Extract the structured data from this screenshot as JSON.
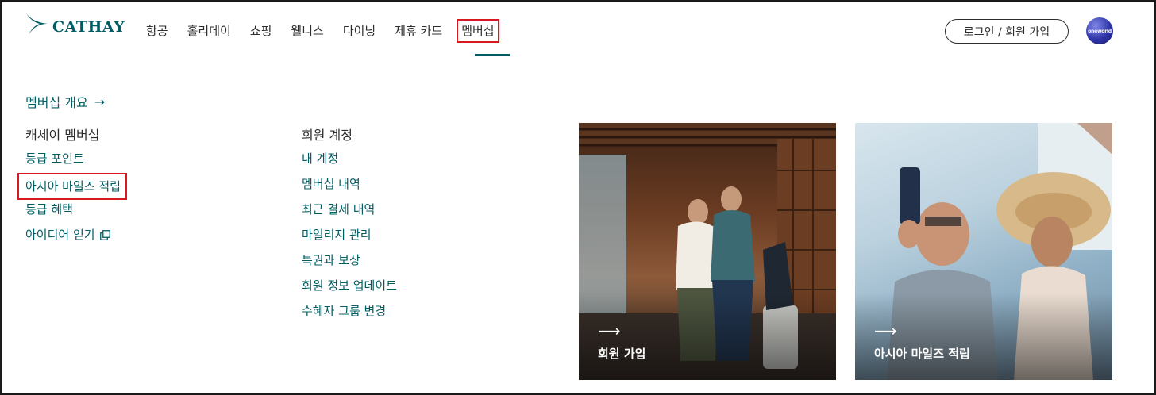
{
  "brand": {
    "name": "CATHAY",
    "color": "#005d63"
  },
  "nav": {
    "items": [
      {
        "label": "항공"
      },
      {
        "label": "홀리데이"
      },
      {
        "label": "쇼핑"
      },
      {
        "label": "웰니스"
      },
      {
        "label": "다이닝"
      },
      {
        "label": "제휴 카드"
      },
      {
        "label": "멤버십",
        "active": true
      }
    ]
  },
  "header": {
    "login_label": "로그인 / 회원 가입",
    "alliance_label": "oneworld"
  },
  "menu": {
    "overview_label": "멤버십 개요",
    "overview_arrow": "→",
    "columns": [
      {
        "title": "캐세이 멤버십",
        "links": [
          {
            "label": "등급 포인트"
          },
          {
            "label": "아시아 마일즈 적립",
            "highlighted": true
          },
          {
            "label": "등급 혜택"
          },
          {
            "label": "아이디어 얻기",
            "external": true
          }
        ]
      },
      {
        "title": "회원 계정",
        "links": [
          {
            "label": "내 계정"
          },
          {
            "label": "멤버십 내역"
          },
          {
            "label": "최근 결제 내역"
          },
          {
            "label": "마일리지 관리"
          },
          {
            "label": "특권과 보상"
          },
          {
            "label": "회원 정보 업데이트"
          },
          {
            "label": "수혜자 그룹 변경"
          }
        ]
      }
    ]
  },
  "cards": [
    {
      "label": "회원 가입",
      "arrow": "⟶"
    },
    {
      "label": "아시아 마일즈 적립",
      "arrow": "⟶"
    }
  ],
  "colors": {
    "accent": "#005d63",
    "highlight_box": "#d71920",
    "text": "#2d2d2d"
  }
}
